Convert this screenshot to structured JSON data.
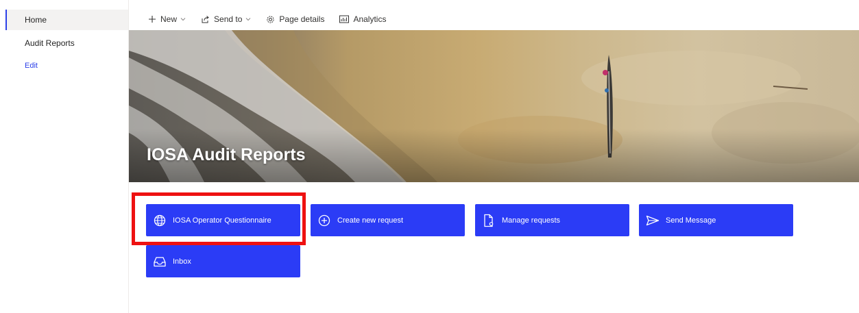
{
  "nav": {
    "items": [
      {
        "label": "Home"
      },
      {
        "label": "Audit Reports"
      }
    ],
    "edit_label": "Edit"
  },
  "commandbar": {
    "new_label": "New",
    "send_to_label": "Send to",
    "page_details_label": "Page details",
    "analytics_label": "Analytics"
  },
  "hero": {
    "title": "IOSA Audit Reports"
  },
  "quicklinks": [
    {
      "label": "IOSA Operator Questionnaire",
      "icon": "globe-icon"
    },
    {
      "label": "Create new request",
      "icon": "add-circle-icon"
    },
    {
      "label": "Manage requests",
      "icon": "document-settings-icon"
    },
    {
      "label": "Send Message",
      "icon": "send-icon"
    },
    {
      "label": "Inbox",
      "icon": "inbox-tray-icon"
    }
  ],
  "colors": {
    "button_blue": "#2b3cf6",
    "highlight_red": "#ee1111",
    "edit_link": "#2b3fe8"
  }
}
